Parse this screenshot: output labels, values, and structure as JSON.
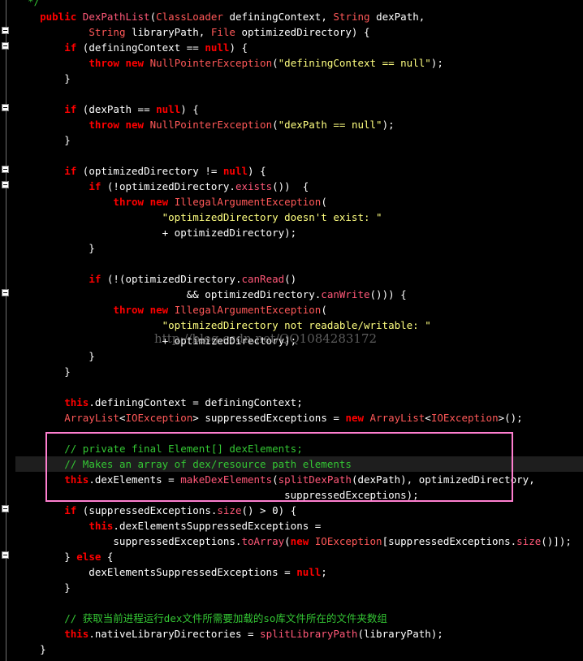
{
  "colors": {
    "background": "#000000",
    "keyword": "#ff0000",
    "type": "#ff5858",
    "function": "#ff5878",
    "string": "#ffff80",
    "comment": "#34c734",
    "plain": "#ffffff",
    "highlight_box": "#ff7fd0"
  },
  "editor": {
    "fold_marker_icon": "minus-box-icon",
    "watermark": "http://blog.csdn.net/QQ1084283172",
    "current_line": 30,
    "lines": [
      [
        [
          "com",
          "  */"
        ]
      ],
      [
        [
          "pl",
          "    "
        ],
        [
          "kw",
          "public"
        ],
        [
          "pl",
          " "
        ],
        [
          "fn",
          "DexPathList"
        ],
        [
          "pl",
          "("
        ],
        [
          "type",
          "ClassLoader"
        ],
        [
          "pl",
          " definingContext, "
        ],
        [
          "type",
          "String"
        ],
        [
          "pl",
          " dexPath,"
        ]
      ],
      [
        [
          "pl",
          "            "
        ],
        [
          "type",
          "String"
        ],
        [
          "pl",
          " libraryPath, "
        ],
        [
          "type",
          "File"
        ],
        [
          "pl",
          " optimizedDirectory) {"
        ]
      ],
      [
        [
          "pl",
          "        "
        ],
        [
          "kw",
          "if"
        ],
        [
          "pl",
          " (definingContext == "
        ],
        [
          "kw",
          "null"
        ],
        [
          "pl",
          ") {"
        ]
      ],
      [
        [
          "pl",
          "            "
        ],
        [
          "kw",
          "throw"
        ],
        [
          "pl",
          " "
        ],
        [
          "kw",
          "new"
        ],
        [
          "pl",
          " "
        ],
        [
          "type",
          "NullPointerException"
        ],
        [
          "pl",
          "("
        ],
        [
          "str",
          "\"definingContext == null\""
        ],
        [
          "pl",
          ");"
        ]
      ],
      [
        [
          "pl",
          "        }"
        ]
      ],
      [
        [
          "pl",
          ""
        ]
      ],
      [
        [
          "pl",
          "        "
        ],
        [
          "kw",
          "if"
        ],
        [
          "pl",
          " (dexPath == "
        ],
        [
          "kw",
          "null"
        ],
        [
          "pl",
          ") {"
        ]
      ],
      [
        [
          "pl",
          "            "
        ],
        [
          "kw",
          "throw"
        ],
        [
          "pl",
          " "
        ],
        [
          "kw",
          "new"
        ],
        [
          "pl",
          " "
        ],
        [
          "type",
          "NullPointerException"
        ],
        [
          "pl",
          "("
        ],
        [
          "str",
          "\"dexPath == null\""
        ],
        [
          "pl",
          ");"
        ]
      ],
      [
        [
          "pl",
          "        }"
        ]
      ],
      [
        [
          "pl",
          ""
        ]
      ],
      [
        [
          "pl",
          "        "
        ],
        [
          "kw",
          "if"
        ],
        [
          "pl",
          " (optimizedDirectory != "
        ],
        [
          "kw",
          "null"
        ],
        [
          "pl",
          ") {"
        ]
      ],
      [
        [
          "pl",
          "            "
        ],
        [
          "kw",
          "if"
        ],
        [
          "pl",
          " (!optimizedDirectory."
        ],
        [
          "fn",
          "exists"
        ],
        [
          "pl",
          "())  {"
        ]
      ],
      [
        [
          "pl",
          "                "
        ],
        [
          "kw",
          "throw"
        ],
        [
          "pl",
          " "
        ],
        [
          "kw",
          "new"
        ],
        [
          "pl",
          " "
        ],
        [
          "type",
          "IllegalArgumentException"
        ],
        [
          "pl",
          "("
        ]
      ],
      [
        [
          "pl",
          "                        "
        ],
        [
          "str",
          "\"optimizedDirectory doesn't exist: \""
        ]
      ],
      [
        [
          "pl",
          "                        + optimizedDirectory);"
        ]
      ],
      [
        [
          "pl",
          "            }"
        ]
      ],
      [
        [
          "pl",
          ""
        ]
      ],
      [
        [
          "pl",
          "            "
        ],
        [
          "kw",
          "if"
        ],
        [
          "pl",
          " (!(optimizedDirectory."
        ],
        [
          "fn",
          "canRead"
        ],
        [
          "pl",
          "()"
        ]
      ],
      [
        [
          "pl",
          "                            && optimizedDirectory."
        ],
        [
          "fn",
          "canWrite"
        ],
        [
          "pl",
          "())) {"
        ]
      ],
      [
        [
          "pl",
          "                "
        ],
        [
          "kw",
          "throw"
        ],
        [
          "pl",
          " "
        ],
        [
          "kw",
          "new"
        ],
        [
          "pl",
          " "
        ],
        [
          "type",
          "IllegalArgumentException"
        ],
        [
          "pl",
          "("
        ]
      ],
      [
        [
          "pl",
          "                        "
        ],
        [
          "str",
          "\"optimizedDirectory not readable/writable: \""
        ]
      ],
      [
        [
          "pl",
          "                        + optimizedDirectory);"
        ]
      ],
      [
        [
          "pl",
          "            }"
        ]
      ],
      [
        [
          "pl",
          "        }"
        ]
      ],
      [
        [
          "pl",
          ""
        ]
      ],
      [
        [
          "pl",
          "        "
        ],
        [
          "kw",
          "this"
        ],
        [
          "pl",
          ".definingContext = definingContext;"
        ]
      ],
      [
        [
          "pl",
          "        "
        ],
        [
          "type",
          "ArrayList"
        ],
        [
          "pl",
          "<"
        ],
        [
          "type",
          "IOException"
        ],
        [
          "pl",
          "> suppressedExceptions = "
        ],
        [
          "kw",
          "new"
        ],
        [
          "pl",
          " "
        ],
        [
          "type",
          "ArrayList"
        ],
        [
          "pl",
          "<"
        ],
        [
          "type",
          "IOException"
        ],
        [
          "pl",
          ">();"
        ]
      ],
      [
        [
          "pl",
          ""
        ]
      ],
      [
        [
          "pl",
          "        "
        ],
        [
          "com",
          "// private final Element[] dexElements;"
        ]
      ],
      [
        [
          "pl",
          "        "
        ],
        [
          "com",
          "// Makes an array of dex/resource path elements"
        ]
      ],
      [
        [
          "pl",
          "        "
        ],
        [
          "kw",
          "this"
        ],
        [
          "pl",
          ".dexElements = "
        ],
        [
          "fn",
          "makeDexElements"
        ],
        [
          "pl",
          "("
        ],
        [
          "fn",
          "splitDexPath"
        ],
        [
          "pl",
          "(dexPath), optimizedDirectory,"
        ]
      ],
      [
        [
          "pl",
          "                                            suppressedExceptions);"
        ]
      ],
      [
        [
          "pl",
          "        "
        ],
        [
          "kw",
          "if"
        ],
        [
          "pl",
          " (suppressedExceptions."
        ],
        [
          "fn",
          "size"
        ],
        [
          "pl",
          "() > 0) {"
        ]
      ],
      [
        [
          "pl",
          "            "
        ],
        [
          "kw",
          "this"
        ],
        [
          "pl",
          ".dexElementsSuppressedExceptions ="
        ]
      ],
      [
        [
          "pl",
          "                suppressedExceptions."
        ],
        [
          "fn",
          "toArray"
        ],
        [
          "pl",
          "("
        ],
        [
          "kw",
          "new"
        ],
        [
          "pl",
          " "
        ],
        [
          "type",
          "IOException"
        ],
        [
          "pl",
          "[suppressedExceptions."
        ],
        [
          "fn",
          "size"
        ],
        [
          "pl",
          "()]);"
        ]
      ],
      [
        [
          "pl",
          "        } "
        ],
        [
          "kw",
          "else"
        ],
        [
          "pl",
          " {"
        ]
      ],
      [
        [
          "pl",
          "            dexElementsSuppressedExceptions = "
        ],
        [
          "kw",
          "null"
        ],
        [
          "pl",
          ";"
        ]
      ],
      [
        [
          "pl",
          "        }"
        ]
      ],
      [
        [
          "pl",
          ""
        ]
      ],
      [
        [
          "pl",
          "        "
        ],
        [
          "com",
          "// 获取当前进程运行dex文件所需要加载的so库文件所在的文件夹数组"
        ]
      ],
      [
        [
          "pl",
          "        "
        ],
        [
          "kw",
          "this"
        ],
        [
          "pl",
          ".nativeLibraryDirectories = "
        ],
        [
          "fn",
          "splitLibraryPath"
        ],
        [
          "pl",
          "(libraryPath);"
        ]
      ],
      [
        [
          "pl",
          "    }"
        ]
      ]
    ]
  }
}
